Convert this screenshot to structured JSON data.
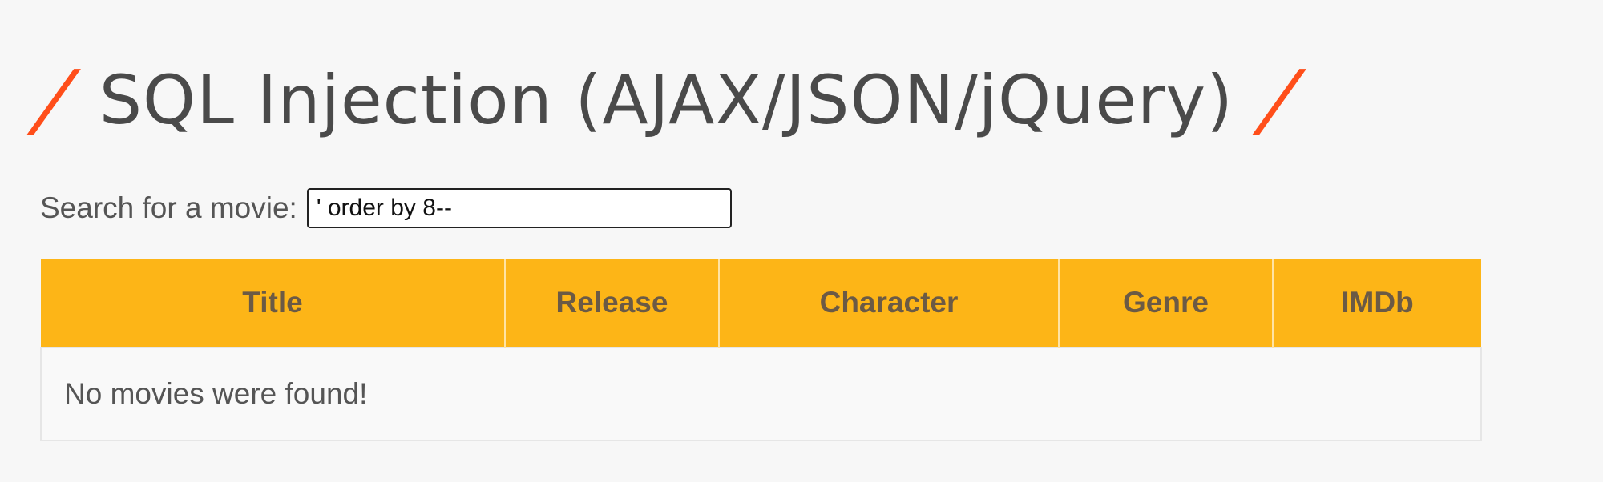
{
  "header": {
    "title": "SQL Injection (AJAX/JSON/jQuery)",
    "slash_left": "/",
    "slash_right": "/"
  },
  "search": {
    "label": "Search for a movie:",
    "value": "' order by 8--"
  },
  "table": {
    "columns": [
      "Title",
      "Release",
      "Character",
      "Genre",
      "IMDb"
    ],
    "empty_message": "No movies were found!"
  },
  "colors": {
    "accent_slash": "#ff4e1a",
    "table_header": "#fdb517",
    "background": "#f7f7f7"
  }
}
